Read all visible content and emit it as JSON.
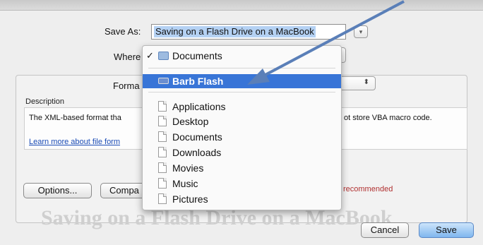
{
  "dialog": {
    "save_as_label": "Save As:",
    "save_as_value": "Saving on a Flash Drive on a MacBook",
    "where_label": "Where",
    "format_label": "Forma",
    "description_label": "Description",
    "description_text": "The XML-based format tha",
    "description_text_tail": "ot store VBA macro code.",
    "learn_more_link": "Learn more about file form",
    "compat_note": "recommended",
    "watermark_text": "Saving on a Flash Drive on a MacBook"
  },
  "buttons": {
    "options": "Options...",
    "compatibility": "Compa",
    "cancel": "Cancel",
    "save": "Save"
  },
  "where_menu": {
    "current": {
      "label": "Documents",
      "icon": "folder-icon",
      "checked": true
    },
    "devices": [
      {
        "label": "Barb Flash",
        "icon": "usb-drive-icon",
        "selected": true
      }
    ],
    "places": [
      {
        "label": "Applications",
        "icon": "document-icon"
      },
      {
        "label": "Desktop",
        "icon": "document-icon"
      },
      {
        "label": "Documents",
        "icon": "document-icon"
      },
      {
        "label": "Downloads",
        "icon": "document-icon"
      },
      {
        "label": "Movies",
        "icon": "document-icon"
      },
      {
        "label": "Music",
        "icon": "document-icon"
      },
      {
        "label": "Pictures",
        "icon": "document-icon"
      }
    ]
  },
  "colors": {
    "selection": "#3875d7",
    "annotation_arrow": "#5a7fb8",
    "link": "#1a4bb5"
  }
}
